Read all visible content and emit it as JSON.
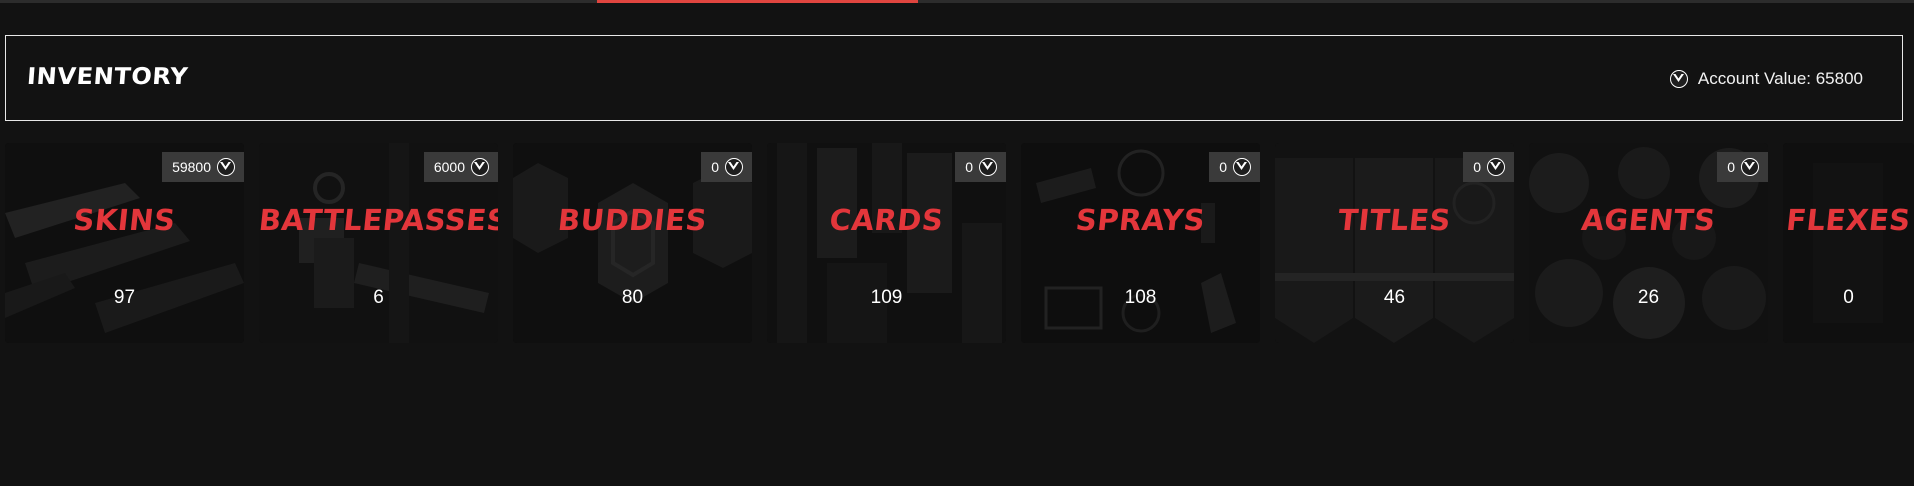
{
  "header": {
    "title": "INVENTORY",
    "account_value_label": "Account Value: 65800"
  },
  "icons": {
    "currency": "valorant-points-icon"
  },
  "colors": {
    "accent": "#e3363b",
    "tab_underline": "#e0453f",
    "badge_bg": "#3a3a3a"
  },
  "cards": [
    {
      "title": "SKINS",
      "count": "97",
      "value": "59800"
    },
    {
      "title": "BATTLEPASSES",
      "count": "6",
      "value": "6000"
    },
    {
      "title": "BUDDIES",
      "count": "80",
      "value": "0"
    },
    {
      "title": "CARDS",
      "count": "109",
      "value": "0"
    },
    {
      "title": "SPRAYS",
      "count": "108",
      "value": "0"
    },
    {
      "title": "TITLES",
      "count": "46",
      "value": "0"
    },
    {
      "title": "AGENTS",
      "count": "26",
      "value": "0"
    },
    {
      "title": "FLEXES",
      "count": "0",
      "value": ""
    }
  ]
}
